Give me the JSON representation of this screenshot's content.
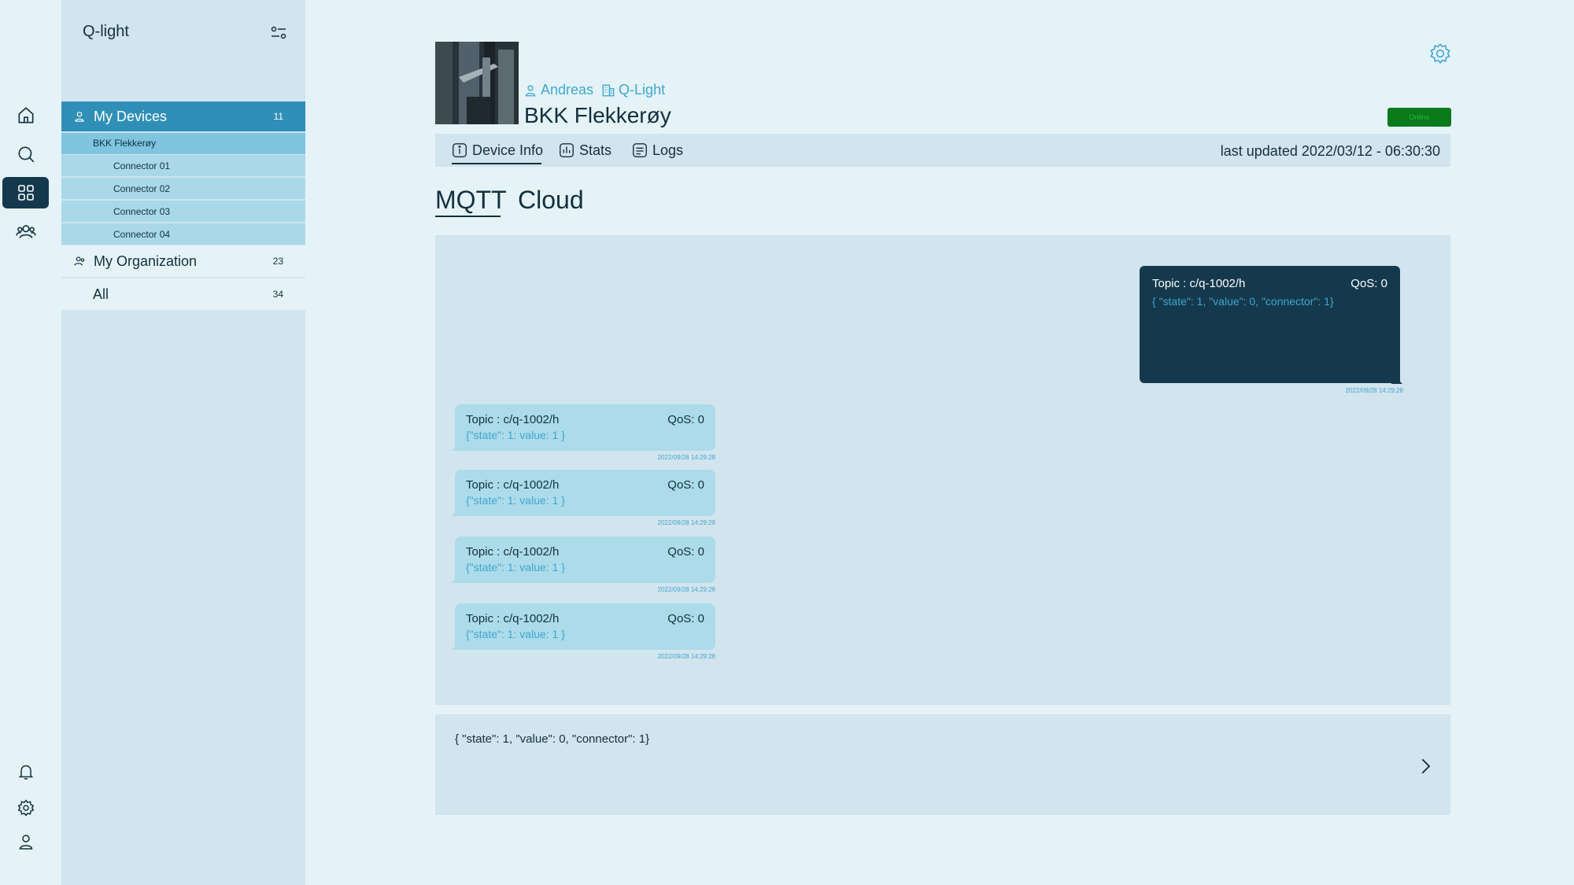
{
  "app": {
    "brand": "Q-light"
  },
  "sidebar": {
    "my_devices": {
      "label": "My Devices",
      "count": "11"
    },
    "selected_device": "BKK Flekkerøy",
    "connectors": [
      "Connector 01",
      "Connector 02",
      "Connector 03",
      "Connector 04"
    ],
    "my_organization": {
      "label": "My Organization",
      "count": "23"
    },
    "all": {
      "label": "All",
      "count": "34"
    }
  },
  "rail": {
    "top_icons": [
      "home-icon",
      "search-icon",
      "grid-icon",
      "users-icon"
    ],
    "active": "grid-icon",
    "bottom_icons": [
      "bell-icon",
      "gear-icon",
      "user-icon"
    ]
  },
  "device": {
    "user": "Andreas",
    "org": "Q-Light",
    "name": "BKK Flekkerøy",
    "status": "Online"
  },
  "tabs": [
    {
      "label": "Device Info",
      "icon": "info-icon",
      "active": true
    },
    {
      "label": "Stats",
      "icon": "stats-icon"
    },
    {
      "label": "Logs",
      "icon": "logs-icon"
    }
  ],
  "last_updated": "last updated 2022/03/12 - 06:30:30",
  "subtabs": [
    {
      "label": "MQTT",
      "active": true
    },
    {
      "label": "Cloud"
    }
  ],
  "messages": {
    "outgoing": {
      "topic": "Topic : c/q-1002/h",
      "qos": "QoS: 0",
      "payload": "{ \"state\": 1, \"value\": 0, \"connector\": 1}",
      "time": "2022/09/28 14:29:28"
    },
    "incoming": [
      {
        "topic": "Topic : c/q-1002/h",
        "qos": "QoS: 0",
        "payload": "{\"state\": 1: value: 1 }",
        "time": "2022/09/28 14:29:28"
      },
      {
        "topic": "Topic : c/q-1002/h",
        "qos": "QoS: 0",
        "payload": "{\"state\": 1: value: 1 }",
        "time": "2022/09/28 14:29:28"
      },
      {
        "topic": "Topic : c/q-1002/h",
        "qos": "QoS: 0",
        "payload": "{\"state\": 1: value: 1 }",
        "time": "2022/09/28 14:29:28"
      },
      {
        "topic": "Topic : c/q-1002/h",
        "qos": "QoS: 0",
        "payload": "{\"state\": 1: value: 1 }",
        "time": "2022/09/28 14:29:28"
      }
    ]
  },
  "composer": {
    "value": "{ \"state\": 1, \"value\": 0, \"connector\": 1}"
  },
  "colors": {
    "dark": "#14394c",
    "accent": "#2f8fb6",
    "link": "#3ea7d0",
    "online": "#0b7a1b"
  }
}
